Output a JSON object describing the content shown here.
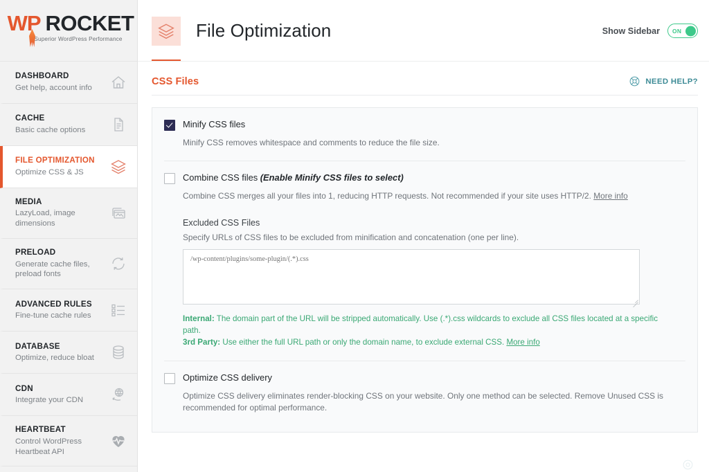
{
  "brand": {
    "logo_wp": "WP",
    "logo_rocket": "ROCKET",
    "tagline": "Superior WordPress Performance",
    "accent_color": "#e4572e"
  },
  "sidebar": {
    "items": [
      {
        "title": "DASHBOARD",
        "desc": "Get help, account info",
        "icon": "home-icon",
        "active": false
      },
      {
        "title": "CACHE",
        "desc": "Basic cache options",
        "icon": "document-icon",
        "active": false
      },
      {
        "title": "FILE OPTIMIZATION",
        "desc": "Optimize CSS & JS",
        "icon": "layers-icon",
        "active": true
      },
      {
        "title": "MEDIA",
        "desc": "LazyLoad, image dimensions",
        "icon": "images-icon",
        "active": false
      },
      {
        "title": "PRELOAD",
        "desc": "Generate cache files, preload fonts",
        "icon": "refresh-icon",
        "active": false
      },
      {
        "title": "ADVANCED RULES",
        "desc": "Fine-tune cache rules",
        "icon": "checklist-icon",
        "active": false
      },
      {
        "title": "DATABASE",
        "desc": "Optimize, reduce bloat",
        "icon": "database-icon",
        "active": false
      },
      {
        "title": "CDN",
        "desc": "Integrate your CDN",
        "icon": "cdn-icon",
        "active": false
      },
      {
        "title": "HEARTBEAT",
        "desc": "Control WordPress Heartbeat API",
        "icon": "heartbeat-icon",
        "active": false
      }
    ]
  },
  "header": {
    "title": "File Optimization",
    "icon": "layers-icon",
    "sidebar_toggle_label": "Show Sidebar",
    "sidebar_toggle_state": "ON",
    "toggle_color": "#3dc98a"
  },
  "section": {
    "title": "CSS Files",
    "need_help_label": "NEED HELP?",
    "need_help_icon": "lifebuoy-icon"
  },
  "options": {
    "minify": {
      "label": "Minify CSS files",
      "checked": true,
      "desc": "Minify CSS removes whitespace and comments to reduce the file size."
    },
    "combine": {
      "label": "Combine CSS files ",
      "label_hint": "(Enable Minify CSS files to select)",
      "checked": false,
      "desc": "Combine CSS merges all your files into 1, reducing HTTP requests. Not recommended if your site uses HTTP/2. ",
      "more_info": "More info"
    },
    "excluded": {
      "title": "Excluded CSS Files",
      "desc": "Specify URLs of CSS files to be excluded from minification and concatenation (one per line).",
      "placeholder": "/wp-content/plugins/some-plugin/(.*).css",
      "value": "",
      "note_internal_label": "Internal:",
      "note_internal_text": " The domain part of the URL will be stripped automatically. Use (.*).css wildcards to exclude all CSS files located at a specific path.",
      "note_3rd_label": "3rd Party:",
      "note_3rd_text": " Use either the full URL path or only the domain name, to exclude external CSS. ",
      "note_more_info": "More info",
      "note_color": "#3aa874"
    },
    "optimize_delivery": {
      "label": "Optimize CSS delivery",
      "checked": false,
      "desc": "Optimize CSS delivery eliminates render-blocking CSS on your website. Only one method can be selected. Remove Unused CSS is recommended for optimal performance."
    }
  }
}
